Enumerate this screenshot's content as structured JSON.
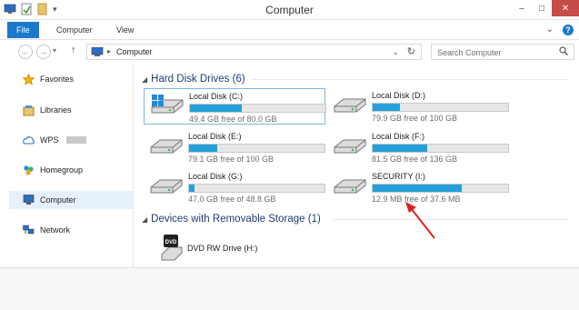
{
  "window": {
    "title": "Computer"
  },
  "ribbon": {
    "tabs": [
      "File",
      "Computer",
      "View"
    ]
  },
  "address": {
    "location": "Computer",
    "search_placeholder": "Search Computer"
  },
  "nav": {
    "items": [
      {
        "label": "Favorites",
        "icon": "star-icon"
      },
      {
        "label": "Libraries",
        "icon": "libraries-icon"
      },
      {
        "label": "WPS",
        "icon": "cloud-icon"
      },
      {
        "label": "Homegroup",
        "icon": "homegroup-icon"
      },
      {
        "label": "Computer",
        "icon": "computer-icon",
        "selected": true
      },
      {
        "label": "Network",
        "icon": "network-icon"
      }
    ]
  },
  "groups": {
    "hard_disks": {
      "header": "Hard Disk Drives (6)",
      "drives": [
        {
          "name": "Local Disk (C:)",
          "free": "49.4 GB free of 80.0 GB",
          "used_fraction": 0.38,
          "system": true
        },
        {
          "name": "Local Disk (D:)",
          "free": "79.9 GB free of 100 GB",
          "used_fraction": 0.2
        },
        {
          "name": "Local Disk (E:)",
          "free": "79.1 GB free of 100 GB",
          "used_fraction": 0.21
        },
        {
          "name": "Local Disk (F:)",
          "free": "81.5 GB free of 136 GB",
          "used_fraction": 0.4
        },
        {
          "name": "Local Disk (G:)",
          "free": "47.0 GB free of 48.8 GB",
          "used_fraction": 0.04
        },
        {
          "name": "SECURITY (I:)",
          "free": "12.9 MB free of 37.6 MB",
          "used_fraction": 0.66
        }
      ]
    },
    "removable": {
      "header": "Devices with Removable Storage (1)",
      "devices": [
        {
          "name": "DVD RW Drive (H:)",
          "badge": "DVD"
        }
      ]
    }
  },
  "colors": {
    "accent": "#1979ca",
    "bar_fill": "#26a0da",
    "annotation_arrow": "#e02020"
  }
}
